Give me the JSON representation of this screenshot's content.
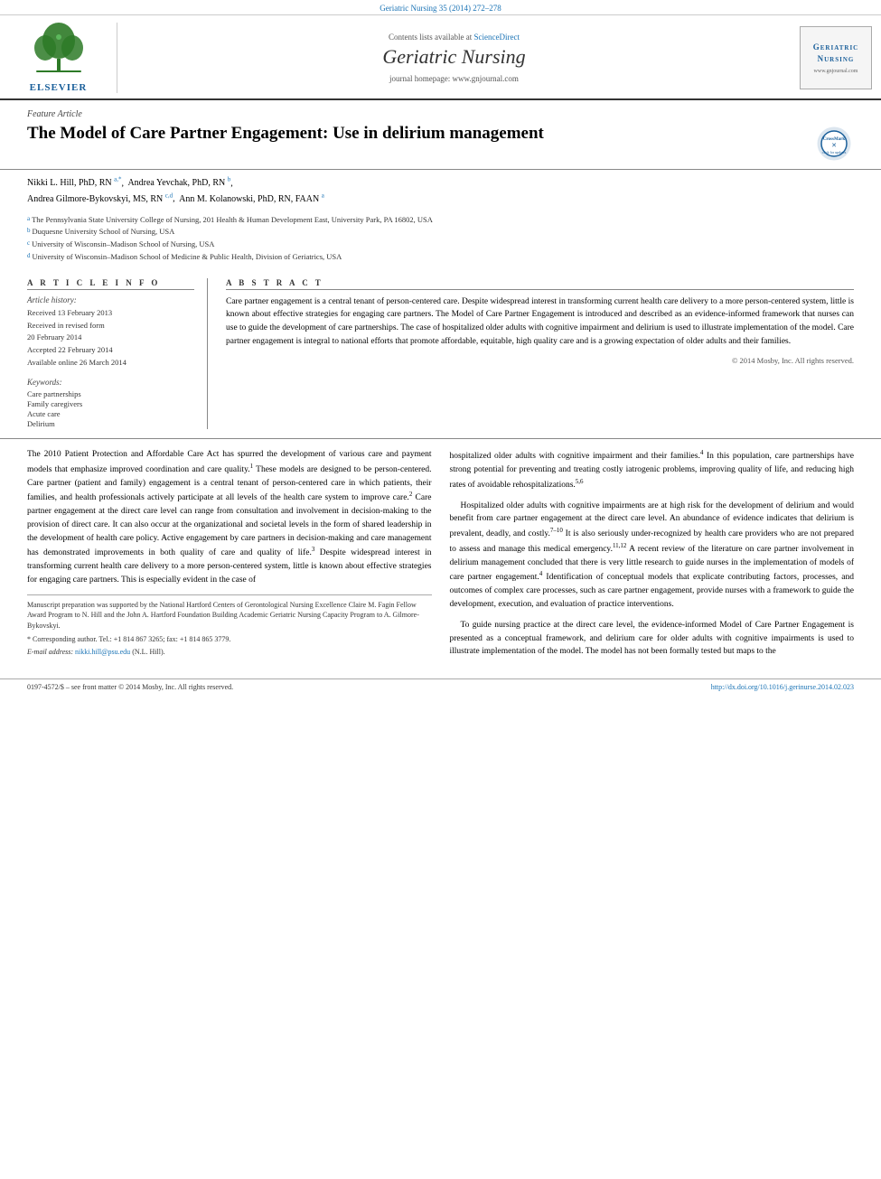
{
  "top_banner": {
    "text": "Geriatric Nursing 35 (2014) 272–278"
  },
  "header": {
    "sciencedirect_text": "Contents lists available at ",
    "sciencedirect_link": "ScienceDirect",
    "journal_title": "Geriatric Nursing",
    "journal_homepage": "journal homepage: www.gnjournal.com",
    "elsevier_label": "ELSEVIER"
  },
  "article": {
    "feature_label": "Feature Article",
    "title": "The Model of Care Partner Engagement: Use in delirium management",
    "authors": [
      {
        "name": "Nikki L. Hill, PhD, RN",
        "sups": [
          "a",
          ",",
          "*"
        ]
      },
      {
        "name": "Andrea Yevchak, PhD, RN",
        "sups": [
          "b"
        ]
      },
      {
        "name": "Andrea Gilmore-Bykovskyi, MS, RN",
        "sups": [
          "c",
          ",",
          "d"
        ]
      },
      {
        "name": "Ann M. Kolanowski, PhD, RN, FAAN",
        "sups": [
          "a"
        ]
      }
    ],
    "affiliations": [
      {
        "sup": "a",
        "text": "The Pennsylvania State University College of Nursing, 201 Health & Human Development East, University Park, PA 16802, USA"
      },
      {
        "sup": "b",
        "text": "Duquesne University School of Nursing, USA"
      },
      {
        "sup": "c",
        "text": "University of Wisconsin–Madison School of Nursing, USA"
      },
      {
        "sup": "d",
        "text": "University of Wisconsin–Madison School of Medicine & Public Health, Division of Geriatrics, USA"
      }
    ]
  },
  "article_info": {
    "section_header": "A R T I C L E   I N F O",
    "history_label": "Article history:",
    "history": [
      "Received 13 February 2013",
      "Received in revised form",
      "20 February 2014",
      "Accepted 22 February 2014",
      "Available online 26 March 2014"
    ],
    "keywords_label": "Keywords:",
    "keywords": [
      "Care partnerships",
      "Family caregivers",
      "Acute care",
      "Delirium"
    ]
  },
  "abstract": {
    "section_header": "A B S T R A C T",
    "text": "Care partner engagement is a central tenant of person-centered care. Despite widespread interest in transforming current health care delivery to a more person-centered system, little is known about effective strategies for engaging care partners. The Model of Care Partner Engagement is introduced and described as an evidence-informed framework that nurses can use to guide the development of care partnerships. The case of hospitalized older adults with cognitive impairment and delirium is used to illustrate implementation of the model. Care partner engagement is integral to national efforts that promote affordable, equitable, high quality care and is a growing expectation of older adults and their families.",
    "copyright": "© 2014 Mosby, Inc. All rights reserved."
  },
  "body": {
    "left_column": [
      {
        "type": "paragraph",
        "text": "The 2010 Patient Protection and Affordable Care Act has spurred the development of various care and payment models that emphasize improved coordination and care quality.¹ These models are designed to be person-centered. Care partner (patient and family) engagement is a central tenant of person-centered care in which patients, their families, and health professionals actively participate at all levels of the health care system to improve care.² Care partner engagement at the direct care level can range from consultation and involvement in decision-making to the provision of direct care. It can also occur at the organizational and societal levels in the form of shared leadership in the development of health care policy. Active engagement by care partners in decision-making and care management has demonstrated improvements in both quality of care and quality of life.³ Despite widespread interest in transforming current health care delivery to a more person-centered system, little is known about effective strategies for engaging care partners. This is especially evident in the case of"
      }
    ],
    "right_column": [
      {
        "type": "paragraph",
        "text": "hospitalized older adults with cognitive impairment and their families.⁴ In this population, care partnerships have strong potential for preventing and treating costly iatrogenic problems, improving quality of life, and reducing high rates of avoidable rehospitalizations.⁵'⁶"
      },
      {
        "type": "paragraph",
        "heading": "Hospitalized older adults with cognitive impairments are at high risk for the development of delirium and would benefit from care partner engagement at the direct care level. An abundance of evidence indicates that delirium is prevalent, deadly, and costly.⁷⁻¹⁰ It is also seriously under-recognized by health care providers who are not prepared to assess and manage this medical emergency.¹¹'¹² A recent review of the literature on care partner involvement in delirium management concluded that there is very little research to guide nurses in the implementation of models of care partner engagement.⁴ Identification of conceptual models that explicate contributing factors, processes, and outcomes of complex care processes, such as care partner engagement, provide nurses with a framework to guide the development, execution, and evaluation of practice interventions."
      },
      {
        "type": "paragraph",
        "text": "To guide nursing practice at the direct care level, the evidence-informed Model of Care Partner Engagement is presented as a conceptual framework, and delirium care for older adults with cognitive impairments is used to illustrate implementation of the model. The model has not been formally tested but maps to the"
      }
    ]
  },
  "footnotes": {
    "manuscript_note": "Manuscript preparation was supported by the National Hartford Centers of Gerontological Nursing Excellence Claire M. Fagin Fellow Award Program to N. Hill and the John A. Hartford Foundation Building Academic Geriatric Nursing Capacity Program to A. Gilmore-Bykovskyi.",
    "corresponding_note": "* Corresponding author. Tel.: +1 814 867 3265; fax: +1 814 865 3779.",
    "email_label": "E-mail address:",
    "email": "nikki.hill@psu.edu",
    "email_suffix": " (N.L. Hill)."
  },
  "bottom_bar": {
    "issn": "0197-4572/$ – see front matter © 2014 Mosby, Inc. All rights reserved.",
    "doi_text": "http://dx.doi.org/10.1016/j.gerinurse.2014.02.023"
  }
}
